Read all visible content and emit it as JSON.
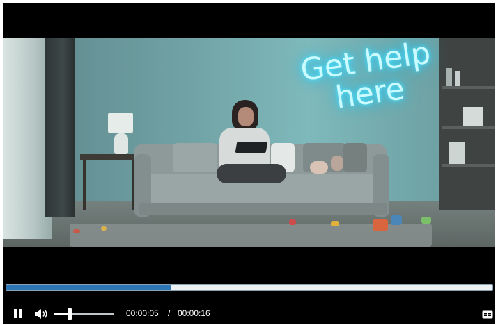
{
  "video": {
    "neon_sign_line1": "Get help",
    "neon_sign_line2": "here"
  },
  "player": {
    "progress_fraction": 0.34,
    "volume_fraction": 0.25,
    "current_time": "00:00:05",
    "time_separator": "/",
    "duration": "00:00:16",
    "icons": {
      "play_pause": "pause-icon",
      "volume": "volume-icon",
      "captions": "closed-captions-icon"
    }
  },
  "colors": {
    "progress_fill": "#2f76b6",
    "progress_track": "#eef1f3",
    "controls_bg": "#000000",
    "neon_glow": "#4ee6ff"
  }
}
